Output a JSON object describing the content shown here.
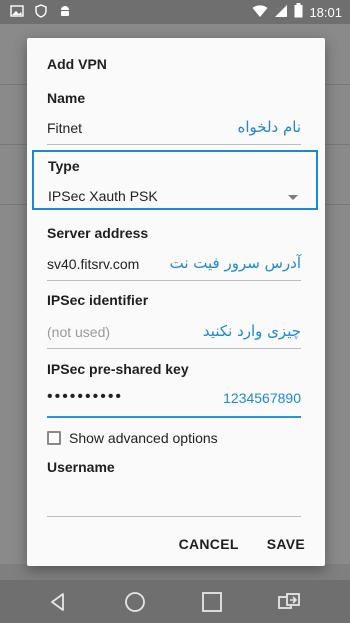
{
  "status_bar": {
    "time": "18:01",
    "left_icons": [
      "image-icon",
      "shield-icon",
      "android-icon"
    ],
    "right_icons": [
      "wifi-icon",
      "signal-icon",
      "battery-icon"
    ]
  },
  "dialog": {
    "title": "Add VPN",
    "name": {
      "label": "Name",
      "value": "Fitnet",
      "annotation": "نام دلخواه"
    },
    "type": {
      "label": "Type",
      "value": "IPSec Xauth PSK"
    },
    "server": {
      "label": "Server address",
      "value": "sv40.fitsrv.com",
      "annotation": "آدرس سرور فیت نت"
    },
    "ipsec_identifier": {
      "label": "IPSec identifier",
      "placeholder": "(not used)",
      "annotation": "چیزی وارد نکنید"
    },
    "psk": {
      "label": "IPSec pre-shared key",
      "masked_value": "••••••••••",
      "annotation": "1234567890"
    },
    "advanced": {
      "label": "Show advanced options",
      "checked": false
    },
    "username": {
      "label": "Username",
      "value": ""
    },
    "buttons": {
      "cancel": "CANCEL",
      "save": "SAVE"
    }
  },
  "colors": {
    "accent": "#1e88d6",
    "dialog_bg": "#fafafa",
    "scrim": "#7f7f7f"
  }
}
